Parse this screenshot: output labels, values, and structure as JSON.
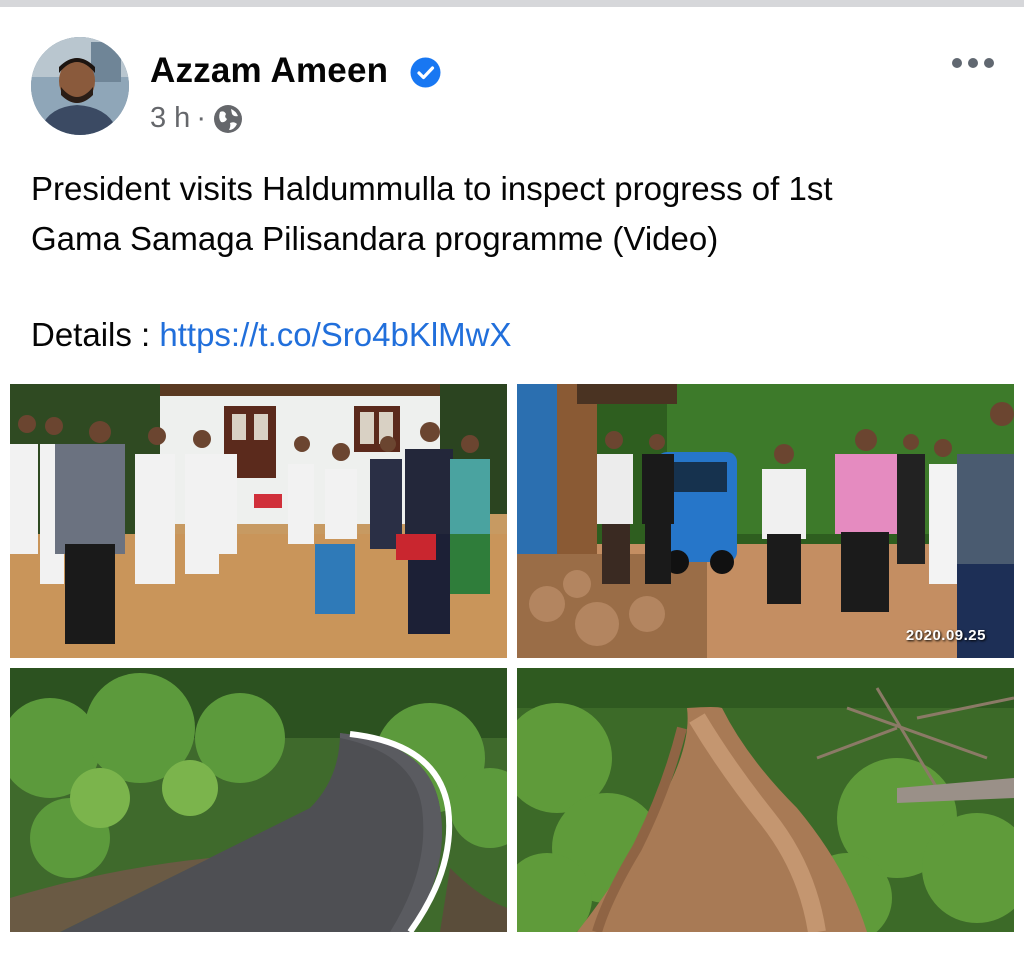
{
  "post": {
    "author": "Azzam Ameen",
    "time": "3 h",
    "separator": "·",
    "privacy_icon": "globe-icon",
    "verified_icon": "verified-badge-icon",
    "more_icon": "more-options-icon",
    "text_lines": [
      "President visits Haldummulla to inspect progress of 1st",
      "Gama Samaga Pilisandara programme (Video)"
    ],
    "details_label": "Details : ",
    "details_link": "https://t.co/Sro4bKlMwX"
  },
  "photos": [
    {
      "name": "photo-officials-at-house"
    },
    {
      "name": "photo-president-site-visit",
      "date_stamp": "2020.09.25"
    },
    {
      "name": "photo-paved-road"
    },
    {
      "name": "photo-dirt-road"
    }
  ],
  "colors": {
    "link": "#216fdb",
    "verified": "#1877f2",
    "meta": "#65676b"
  }
}
